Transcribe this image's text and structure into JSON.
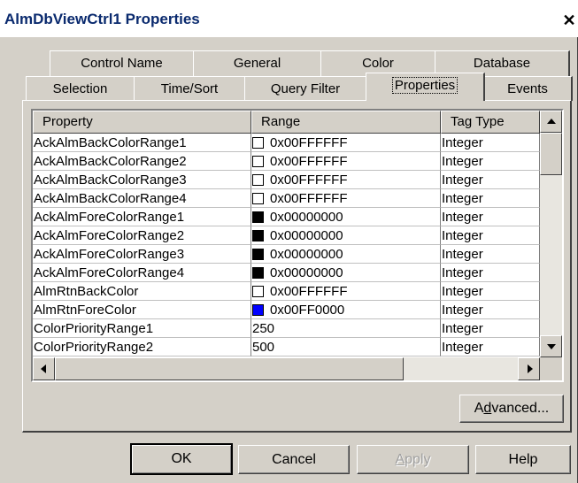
{
  "window": {
    "title": "AlmDbViewCtrl1 Properties",
    "close_glyph": "✕"
  },
  "tabs_row1": [
    "Control Name",
    "General",
    "Color",
    "Database"
  ],
  "tabs_row2": [
    "Selection",
    "Time/Sort",
    "Query Filter",
    "Properties",
    "Events"
  ],
  "active_tab": "Properties",
  "table": {
    "columns": [
      "Property",
      "Range",
      "Tag Type"
    ],
    "rows": [
      {
        "property": "AckAlmBackColorRange1",
        "range": "0x00FFFFFF",
        "swatch": "#ffffff",
        "tag_type": "Integer"
      },
      {
        "property": "AckAlmBackColorRange2",
        "range": "0x00FFFFFF",
        "swatch": "#ffffff",
        "tag_type": "Integer"
      },
      {
        "property": "AckAlmBackColorRange3",
        "range": "0x00FFFFFF",
        "swatch": "#ffffff",
        "tag_type": "Integer"
      },
      {
        "property": "AckAlmBackColorRange4",
        "range": "0x00FFFFFF",
        "swatch": "#ffffff",
        "tag_type": "Integer"
      },
      {
        "property": "AckAlmForeColorRange1",
        "range": "0x00000000",
        "swatch": "#000000",
        "tag_type": "Integer"
      },
      {
        "property": "AckAlmForeColorRange2",
        "range": "0x00000000",
        "swatch": "#000000",
        "tag_type": "Integer"
      },
      {
        "property": "AckAlmForeColorRange3",
        "range": "0x00000000",
        "swatch": "#000000",
        "tag_type": "Integer"
      },
      {
        "property": "AckAlmForeColorRange4",
        "range": "0x00000000",
        "swatch": "#000000",
        "tag_type": "Integer"
      },
      {
        "property": "AlmRtnBackColor",
        "range": "0x00FFFFFF",
        "swatch": "#ffffff",
        "tag_type": "Integer"
      },
      {
        "property": "AlmRtnForeColor",
        "range": "0x00FF0000",
        "swatch": "#0000ff",
        "tag_type": "Integer"
      },
      {
        "property": "ColorPriorityRange1",
        "range": "250",
        "swatch": null,
        "tag_type": "Integer"
      },
      {
        "property": "ColorPriorityRange2",
        "range": "500",
        "swatch": null,
        "tag_type": "Integer"
      }
    ]
  },
  "buttons": {
    "advanced": {
      "pre": "A",
      "ul": "d",
      "post": "vanced..."
    },
    "ok": "OK",
    "cancel": "Cancel",
    "apply": {
      "ul": "A",
      "post": "pply"
    },
    "help": "Help"
  }
}
